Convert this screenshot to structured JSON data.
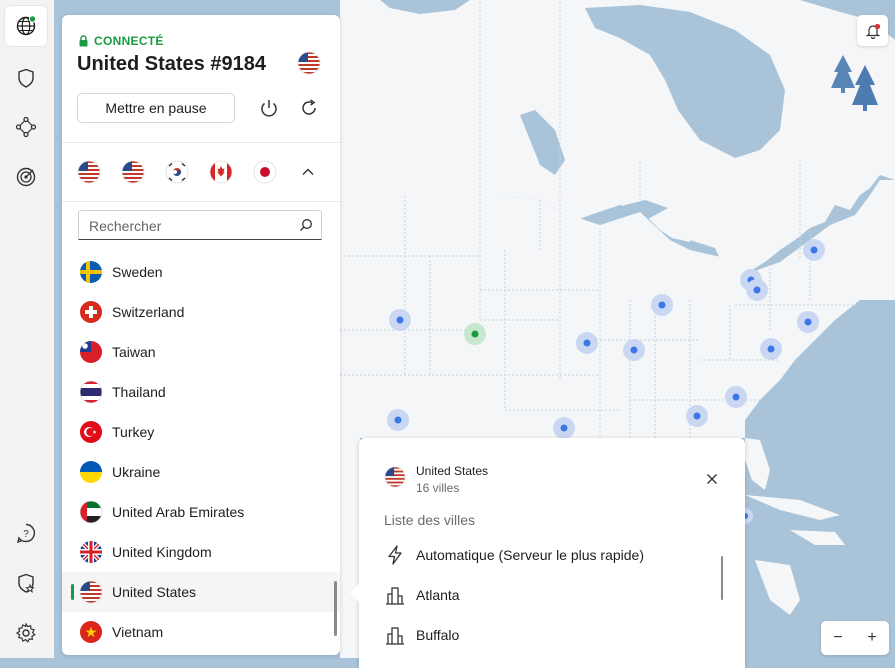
{
  "connection": {
    "status": "CONNECTÉ",
    "server": "United States #9184",
    "flag": "us",
    "pause_label": "Mettre en pause"
  },
  "recent_flags": [
    "us",
    "us",
    "kr",
    "ca",
    "jp"
  ],
  "search": {
    "placeholder": "Rechercher"
  },
  "countries": [
    {
      "name": "Sweden",
      "flag": "se"
    },
    {
      "name": "Switzerland",
      "flag": "ch"
    },
    {
      "name": "Taiwan",
      "flag": "tw"
    },
    {
      "name": "Thailand",
      "flag": "th"
    },
    {
      "name": "Turkey",
      "flag": "tr"
    },
    {
      "name": "Ukraine",
      "flag": "ua"
    },
    {
      "name": "United Arab Emirates",
      "flag": "ae"
    },
    {
      "name": "United Kingdom",
      "flag": "gb"
    },
    {
      "name": "United States",
      "flag": "us",
      "selected": true
    },
    {
      "name": "Vietnam",
      "flag": "vn"
    }
  ],
  "popup": {
    "country": "United States",
    "count": "16 villes",
    "section": "Liste des villes",
    "items": [
      {
        "label": "Automatique (Serveur le plus rapide)",
        "icon": "lightning-icon"
      },
      {
        "label": "Atlanta",
        "icon": "city-icon"
      },
      {
        "label": "Buffalo",
        "icon": "city-icon"
      }
    ]
  },
  "rail": [
    "globe-icon",
    "shield-icon",
    "meshnet-icon",
    "target-icon",
    "help-icon",
    "shield-star-icon",
    "settings-icon"
  ],
  "zoom": {
    "minus": "−",
    "plus": "+"
  },
  "colors": {
    "connected": "#1a9b43",
    "accent": "#3b78e7",
    "water": "#a9c3d9",
    "land": "#f4f6f8"
  }
}
